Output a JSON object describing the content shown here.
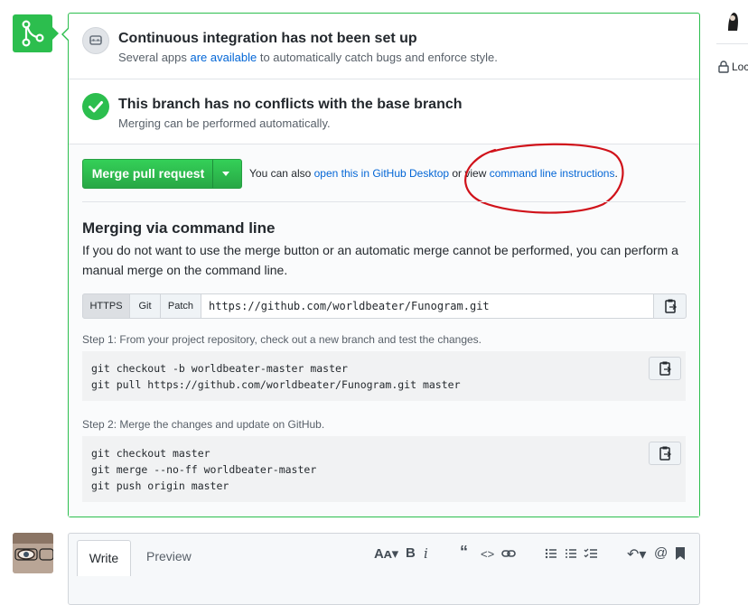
{
  "ci": {
    "title": "Continuous integration has not been set up",
    "sub_prefix": "Several apps ",
    "sub_link": "are available",
    "sub_suffix": " to automatically catch bugs and enforce style."
  },
  "conflicts": {
    "title": "This branch has no conflicts with the base branch",
    "sub": "Merging can be performed automatically."
  },
  "merge": {
    "button_label": "Merge pull request",
    "also_prefix": "You can also ",
    "desktop_link": "open this in GitHub Desktop",
    "also_middle": " or view ",
    "cli_link": "command line instructions",
    "also_suffix": "."
  },
  "command_line": {
    "heading": "Merging via command line",
    "description": "If you do not want to use the merge button or an automatic merge cannot be performed, you can perform a manual merge on the command line.",
    "protocols": [
      "HTTPS",
      "Git",
      "Patch"
    ],
    "selected_protocol": "HTTPS",
    "clone_url": "https://github.com/worldbeater/Funogram.git",
    "step1_label": "Step 1:",
    "step1_text": " From your project repository, check out a new branch and test the changes.",
    "step1_code": [
      "git checkout -b worldbeater-master master",
      "git pull https://github.com/worldbeater/Funogram.git master"
    ],
    "step2_label": "Step 2:",
    "step2_text": " Merge the changes and update on GitHub.",
    "step2_code": [
      "git checkout master",
      "git merge --no-ff worldbeater-master",
      "git push origin master"
    ]
  },
  "comment": {
    "tabs": [
      "Write",
      "Preview"
    ]
  },
  "sidebar": {
    "lock_label": "Loc"
  },
  "colors": {
    "success": "#2cbe4e",
    "link": "#0366d6",
    "annotation": "#d0121a"
  }
}
